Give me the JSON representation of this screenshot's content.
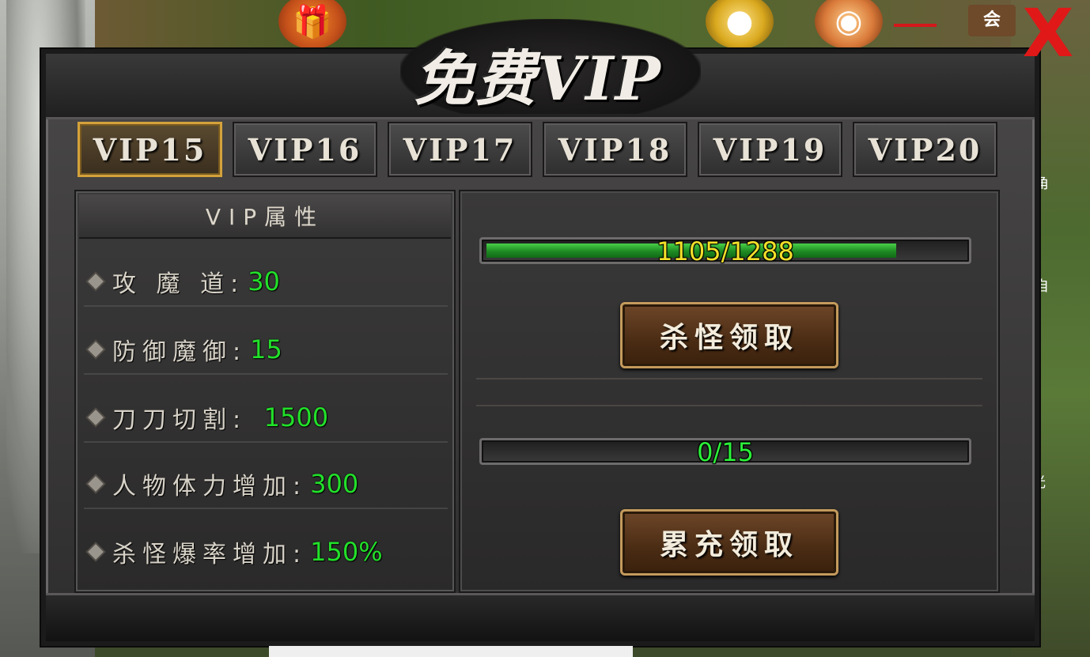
{
  "window": {
    "title": "免费VIP",
    "close_label": "X",
    "top_tag": "会"
  },
  "background_icons": [
    "gift-icon",
    "gold-ingot-icon",
    "pet-icon"
  ],
  "side_labels": {
    "role": "角",
    "auto": "自",
    "light": "光"
  },
  "tabs": [
    {
      "label": "VIP15",
      "active": true
    },
    {
      "label": "VIP16",
      "active": false
    },
    {
      "label": "VIP17",
      "active": false
    },
    {
      "label": "VIP18",
      "active": false
    },
    {
      "label": "VIP19",
      "active": false
    },
    {
      "label": "VIP20",
      "active": false
    }
  ],
  "attributes": {
    "header": "VIP属性",
    "items": [
      {
        "label": "攻 魔 道:",
        "value": "30"
      },
      {
        "label": "防御魔御:",
        "value": "15"
      },
      {
        "label": "刀刀切割: ",
        "value": "1500"
      },
      {
        "label": "人物体力增加:",
        "value": "300"
      },
      {
        "label": "杀怪爆率增加:",
        "value": "150%"
      }
    ]
  },
  "rewards": {
    "kill": {
      "progress_text": "1105/1288",
      "current": 1105,
      "total": 1288,
      "button_label": "杀怪领取"
    },
    "recharge": {
      "progress_text": "0/15",
      "current": 0,
      "total": 15,
      "button_label": "累充领取"
    }
  },
  "colors": {
    "value_green": "#22e02a",
    "progress_text_yellow": "#f2e02a",
    "active_tab_border": "#d4a23b",
    "close_red": "#e01818"
  }
}
